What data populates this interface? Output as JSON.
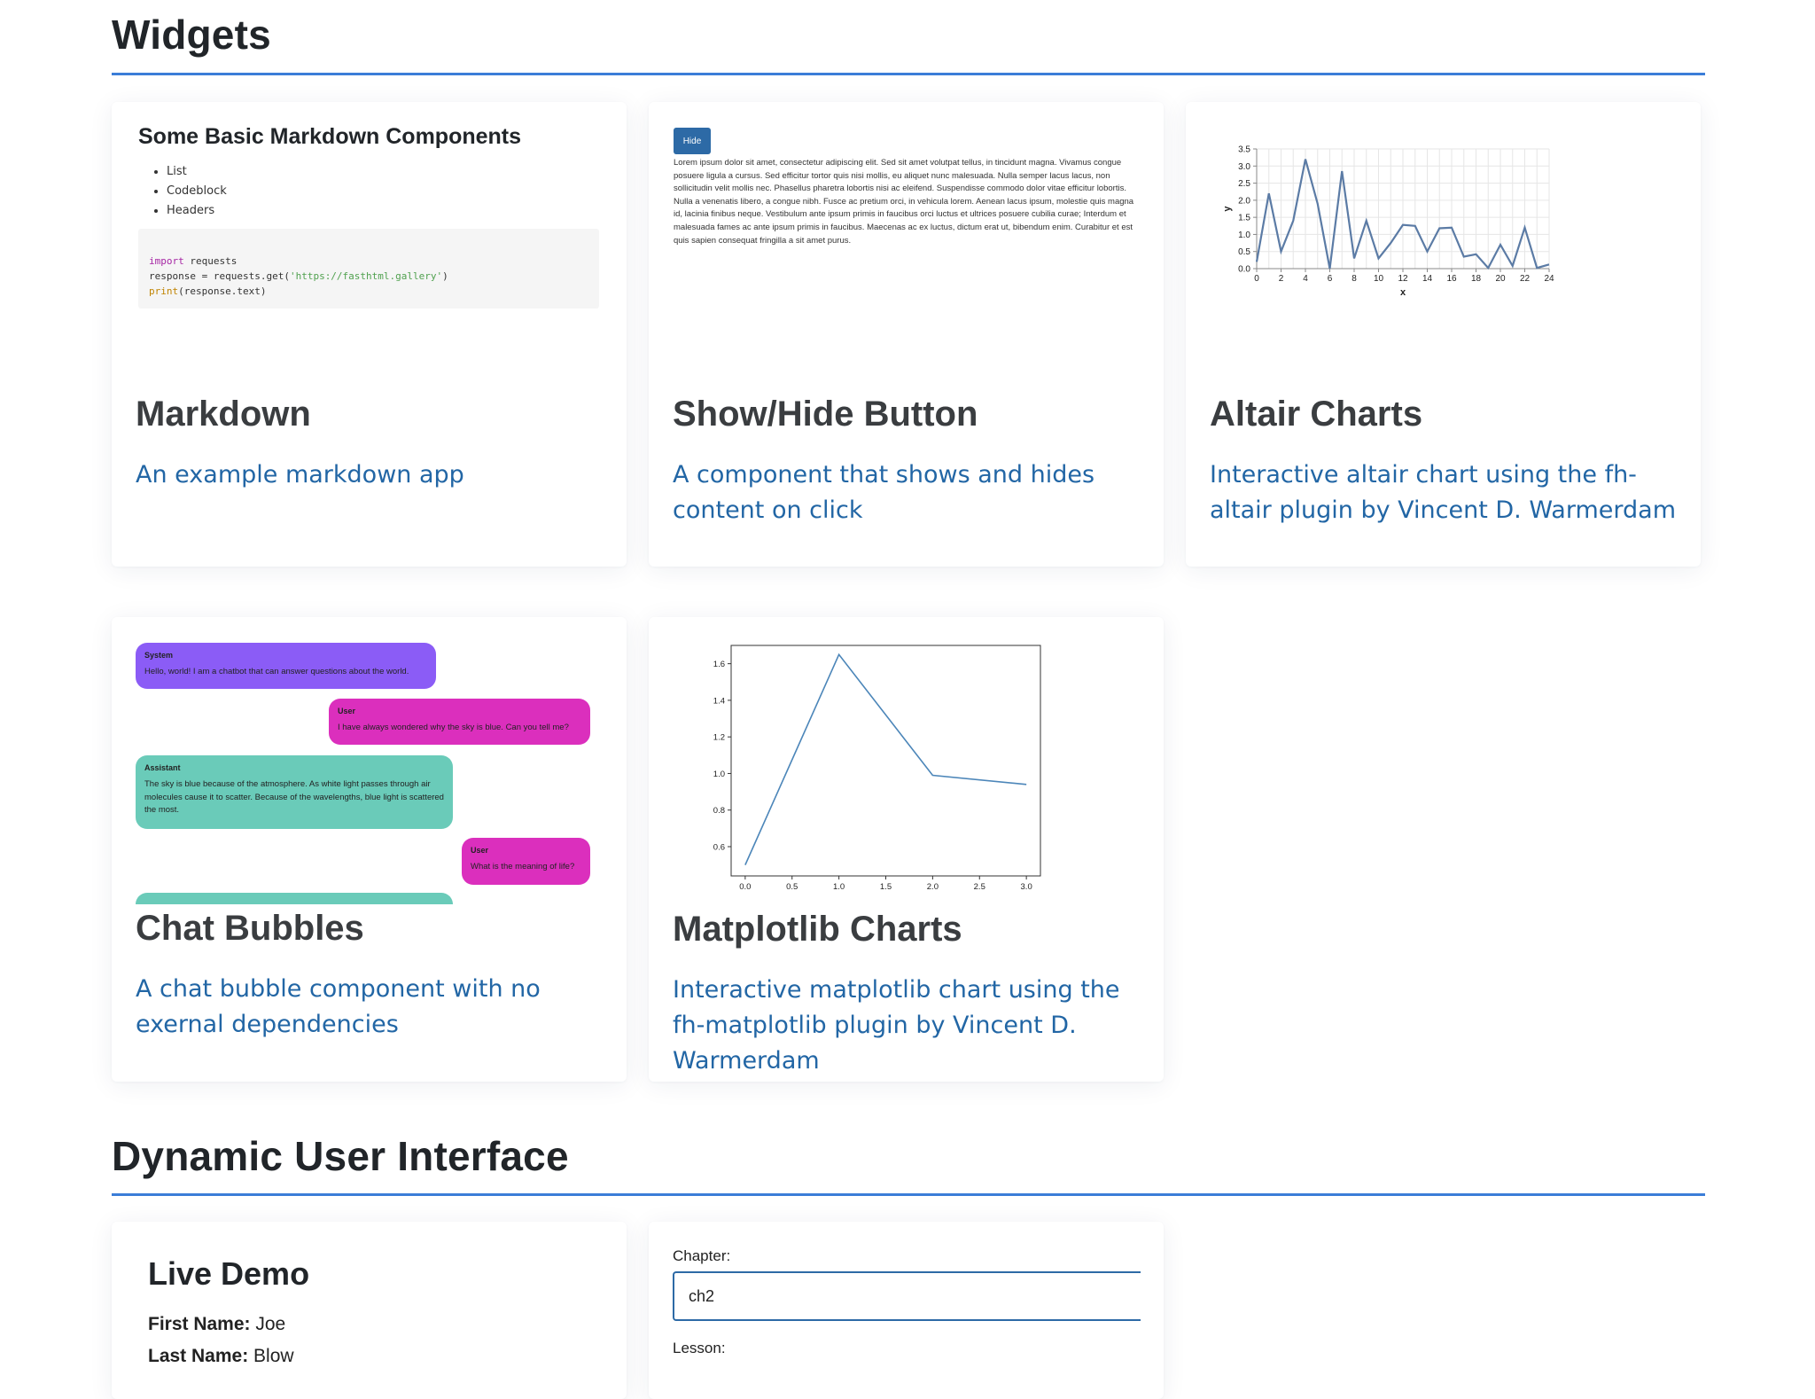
{
  "sections": {
    "widgets_title": "Widgets",
    "dynamic_title": "Dynamic User Interface"
  },
  "colors": {
    "accent": "#3b7dd8",
    "link": "#2266a5",
    "chat_system": "#8b5cf6",
    "chat_user": "#db2fbd",
    "chat_assistant": "#6acbb9",
    "altair_line": "#5b7ba5"
  },
  "cards": {
    "markdown": {
      "title": "Markdown",
      "desc": "An example markdown app",
      "preview": {
        "heading": "Some Basic Markdown Components",
        "list": [
          "List",
          "Codeblock",
          "Headers"
        ],
        "code": {
          "line1_kw": "import",
          "line1_rest": " requests",
          "line2_pre": "response = requests.get(",
          "line2_str": "'https://fasthtml.gallery'",
          "line2_post": ")",
          "line3_fn": "print",
          "line3_rest": "(response.text)"
        }
      }
    },
    "showhide": {
      "title": "Show/Hide Button",
      "desc": "A component that shows and hides content on click",
      "preview": {
        "button_label": "Hide",
        "text": "Lorem ipsum dolor sit amet, consectetur adipiscing elit. Sed sit amet volutpat tellus, in tincidunt magna. Vivamus congue posuere ligula a cursus. Sed efficitur tortor quis nisi mollis, eu aliquet nunc malesuada. Nulla semper lacus lacus, non sollicitudin velit mollis nec. Phasellus pharetra lobortis nisi ac eleifend. Suspendisse commodo dolor vitae efficitur lobortis. Nulla a venenatis libero, a congue nibh. Fusce ac pretium orci, in vehicula lorem. Aenean lacus ipsum, molestie quis magna id, lacinia finibus neque. Vestibulum ante ipsum primis in faucibus orci luctus et ultrices posuere cubilia curae; Interdum et malesuada fames ac ante ipsum primis in faucibus. Maecenas ac ex luctus, dictum erat ut, bibendum enim. Curabitur et est quis sapien consequat fringilla a sit amet purus."
      }
    },
    "altair": {
      "title": "Altair Charts",
      "desc": "Interactive altair chart using the fh-altair plugin by Vincent D. Warmerdam"
    },
    "chat": {
      "title": "Chat Bubbles",
      "desc": "A chat bubble component with no exernal dependencies",
      "preview": {
        "messages": [
          {
            "role": "System",
            "text": "Hello, world! I am a chatbot that can answer questions about the world."
          },
          {
            "role": "User",
            "text": "I have always wondered why the sky is blue. Can you tell me?"
          },
          {
            "role": "Assistant",
            "text": "The sky is blue because of the atmosphere. As white light passes through air molecules cause it to scatter. Because of the wavelengths, blue light is scattered the most."
          },
          {
            "role": "User",
            "text": "What is the meaning of life?"
          },
          {
            "role": "Assistant",
            "text": ""
          }
        ]
      }
    },
    "matplotlib": {
      "title": "Matplotlib Charts",
      "desc": "Interactive matplotlib chart using the fh-matplotlib plugin by Vincent D. Warmerdam"
    },
    "live_demo": {
      "title": "Live Demo",
      "first_name_label": "First Name:",
      "first_name_value": "Joe",
      "last_name_label": "Last Name:",
      "last_name_value": "Blow"
    },
    "form": {
      "chapter_label": "Chapter:",
      "chapter_value": "ch2",
      "lesson_label": "Lesson:"
    }
  },
  "chart_data": [
    {
      "type": "line",
      "chart": "altair",
      "xlabel": "x",
      "ylabel": "y",
      "xlim": [
        0,
        24
      ],
      "ylim": [
        0,
        3.5
      ],
      "xticks": [
        0,
        2,
        4,
        6,
        8,
        10,
        12,
        14,
        16,
        18,
        20,
        22,
        24
      ],
      "yticks": [
        0.0,
        0.5,
        1.0,
        1.5,
        2.0,
        2.5,
        3.0,
        3.5
      ],
      "grid": true,
      "x": [
        0,
        1,
        2,
        3,
        4,
        5,
        6,
        7,
        8,
        9,
        10,
        11,
        12,
        13,
        14,
        15,
        16,
        17,
        18,
        19,
        20,
        21,
        22,
        23,
        24
      ],
      "y": [
        0.2,
        2.2,
        0.5,
        1.4,
        3.2,
        1.9,
        0.0,
        2.85,
        0.3,
        1.4,
        0.3,
        0.75,
        1.28,
        1.25,
        0.5,
        1.18,
        1.2,
        0.35,
        0.42,
        0.02,
        0.7,
        0.08,
        1.2,
        0.02,
        0.12
      ]
    },
    {
      "type": "line",
      "chart": "matplotlib",
      "xlim": [
        -0.15,
        3.15
      ],
      "ylim": [
        0.44,
        1.7
      ],
      "xticks": [
        0.0,
        0.5,
        1.0,
        1.5,
        2.0,
        2.5,
        3.0
      ],
      "yticks": [
        0.6,
        0.8,
        1.0,
        1.2,
        1.4,
        1.6
      ],
      "grid": false,
      "x": [
        0.0,
        1.0,
        2.0,
        3.0
      ],
      "y": [
        0.5,
        1.65,
        0.99,
        0.94
      ]
    }
  ]
}
